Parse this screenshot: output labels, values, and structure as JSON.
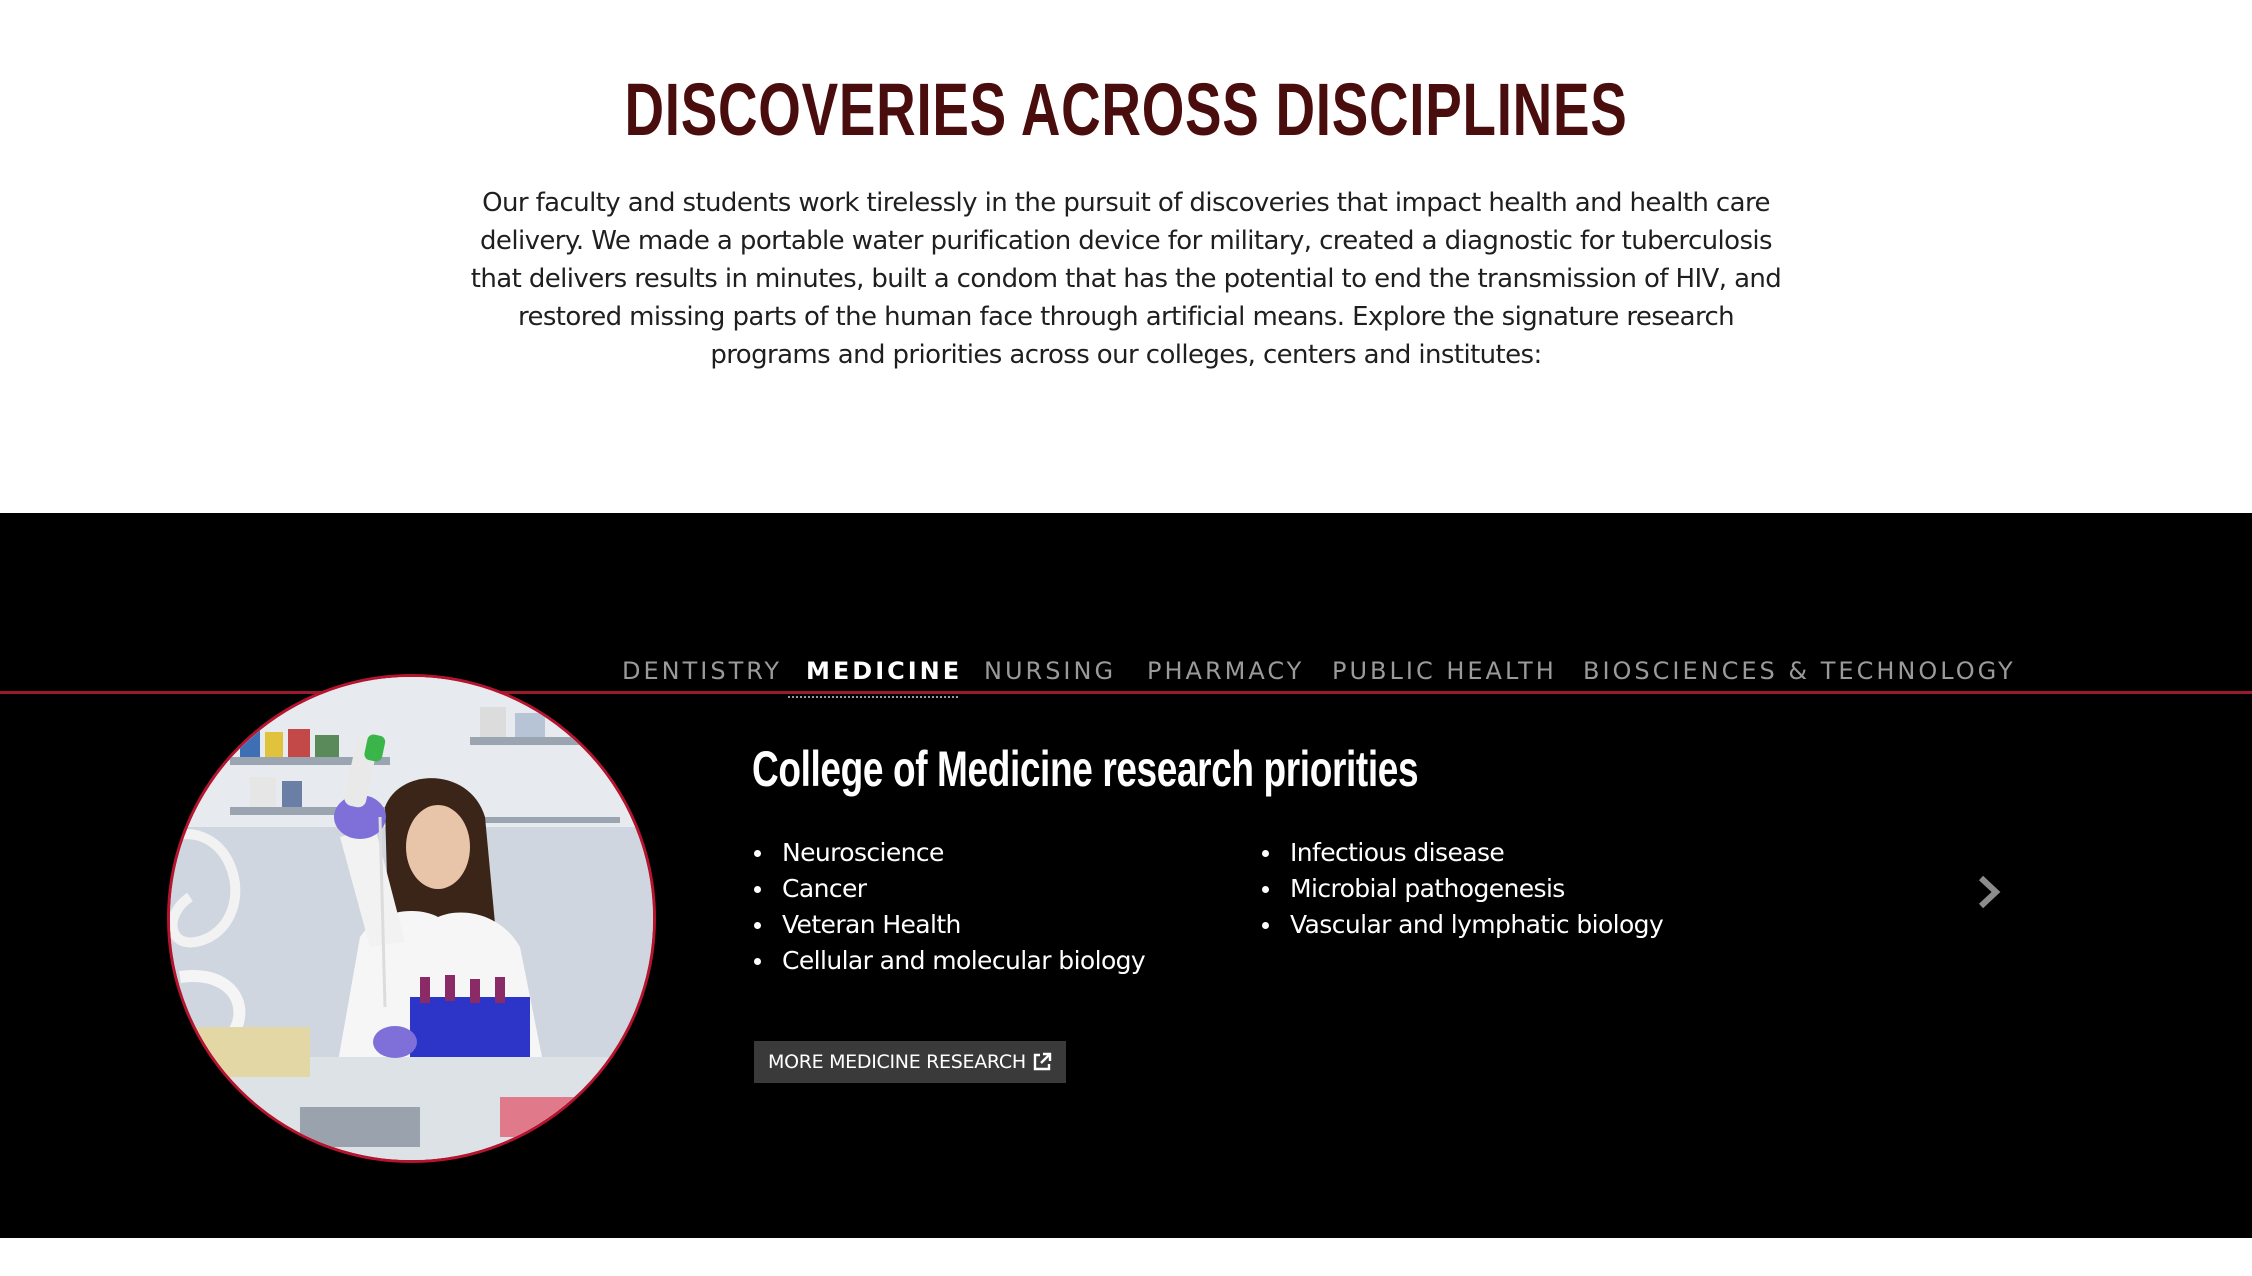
{
  "intro": {
    "title": "DISCOVERIES ACROSS DISCIPLINES",
    "body": "Our faculty and students work tirelessly in the pursuit of discoveries that impact health and health care delivery. We made a portable water purification device for military, created a diagnostic for tuberculosis that delivers results in minutes, built a condom that has the potential to end the transmission of HIV, and restored missing parts of the human face through artificial means. Explore the signature research programs and priorities across our colleges, centers and institutes:"
  },
  "tabs": [
    {
      "label": "DENTISTRY",
      "active": false
    },
    {
      "label": "MEDICINE",
      "active": true
    },
    {
      "label": "NURSING",
      "active": false
    },
    {
      "label": "PHARMACY",
      "active": false
    },
    {
      "label": "PUBLIC HEALTH",
      "active": false
    },
    {
      "label": "BIOSCIENCES & TECHNOLOGY",
      "active": false
    }
  ],
  "panel": {
    "title": "College of Medicine research priorities",
    "left_items": [
      "Neuroscience",
      "Cancer",
      "Veteran Health",
      "Cellular and molecular biology"
    ],
    "right_items": [
      "Infectious disease",
      "Microbial pathogenesis",
      "Vascular and lymphatic biology"
    ],
    "button_label": "MORE MEDICINE RESEARCH",
    "button_icon": "external-link-icon",
    "next_icon": "chevron-right-icon",
    "photo_icon": "researcher-photo"
  },
  "colors": {
    "title": "#4a0d0d",
    "accent_rule": "#9b1b2e",
    "photo_border": "#b5142f",
    "band_bg": "#000000"
  }
}
